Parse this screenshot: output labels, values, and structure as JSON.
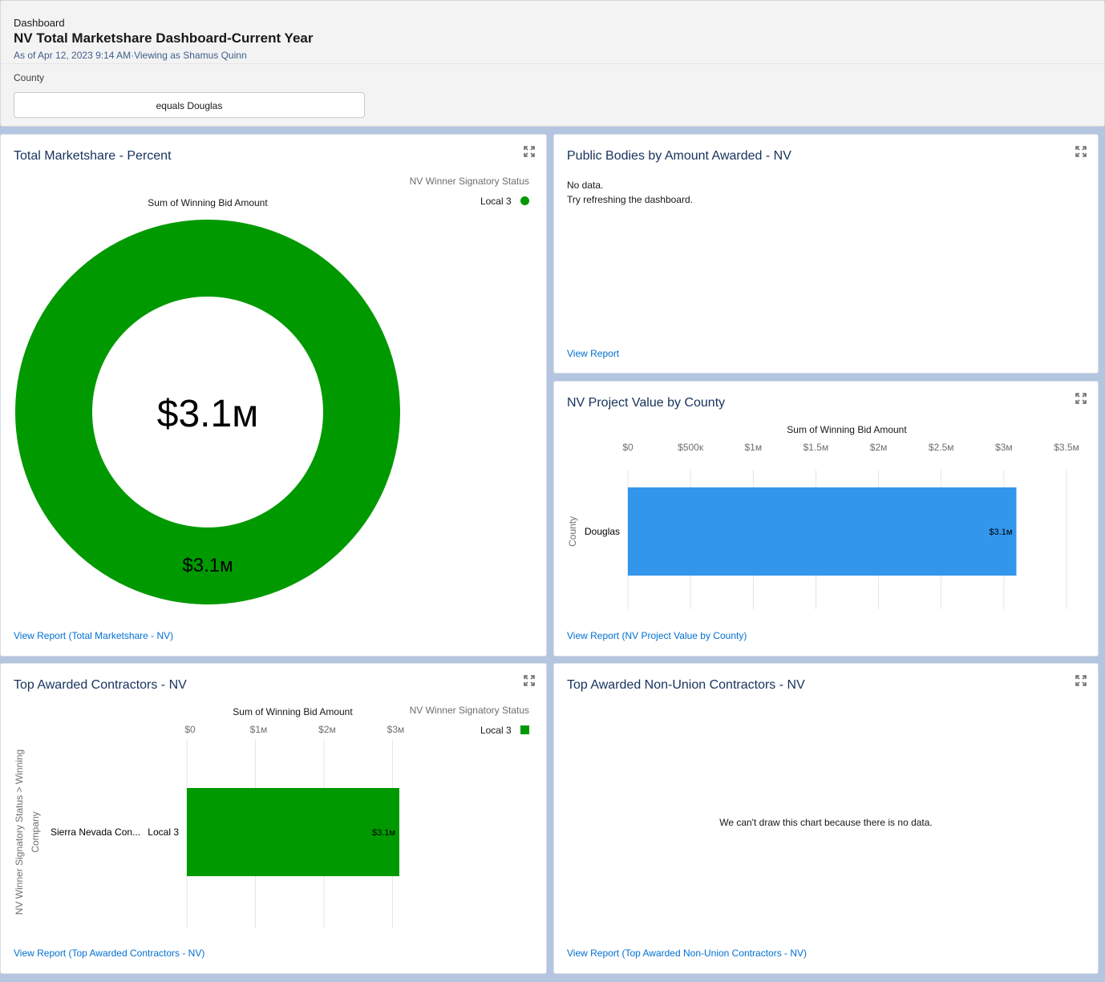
{
  "header": {
    "eyebrow": "Dashboard",
    "title": "NV Total Marketshare Dashboard-Current Year",
    "subtitle": "As of Apr 12, 2023 9:14 AM·Viewing as Shamus Quinn",
    "filter_label": "County",
    "filter_value": "equals Douglas"
  },
  "cards": {
    "marketshare": {
      "title": "Total Marketshare - Percent",
      "legend_title": "NV Winner Signatory Status",
      "legend_item": "Local 3",
      "measure_label": "Sum of Winning Bid Amount",
      "center_value": "$3.1м",
      "link": "View Report (Total Marketshare - NV)"
    },
    "public_bodies": {
      "title": "Public Bodies by Amount Awarded - NV",
      "no_data_line1": "No data.",
      "no_data_line2": "Try refreshing the dashboard.",
      "link": "View Report"
    },
    "project_value": {
      "title": "NV Project Value by County",
      "axis_title": "Sum of Winning Bid Amount",
      "y_axis_title": "County",
      "link": "View Report (NV Project Value by County)"
    },
    "top_contractors": {
      "title": "Top Awarded Contractors - NV",
      "axis_title": "Sum of Winning Bid Amount",
      "legend_title": "NV Winner Signatory Status",
      "legend_item": "Local 3",
      "y_axis_title_line1": "NV Winner Signatory Status  >  Winning",
      "y_axis_title_line2": "Company",
      "link": "View Report (Top Awarded Contractors - NV)"
    },
    "non_union": {
      "title": "Top Awarded Non-Union Contractors - NV",
      "message": "We can't draw this chart because there is no data.",
      "link": "View Report (Top Awarded Non-Union Contractors - NV)"
    }
  },
  "colors": {
    "green": "#009900",
    "blue": "#3296ed",
    "link": "#0070d2",
    "title": "#16325c"
  },
  "icons": [
    "expand-icon"
  ],
  "chart_data": [
    {
      "type": "pie",
      "variant": "donut",
      "title": "Total Marketshare - Percent",
      "measure": "Sum of Winning Bid Amount",
      "legend_title": "NV Winner Signatory Status",
      "legend_position": "top-right",
      "slices": [
        {
          "name": "Local 3",
          "value": 3.1,
          "label": "$3.1м",
          "color": "#009900"
        }
      ],
      "center_label": "$3.1м"
    },
    {
      "type": "bar",
      "orientation": "horizontal",
      "title": "NV Project Value by County",
      "xlabel": "Sum of Winning Bid Amount",
      "ylabel": "County",
      "categories": [
        "Douglas"
      ],
      "values": [
        3.1
      ],
      "value_labels": [
        "$3.1м"
      ],
      "xlim": [
        0,
        3.5
      ],
      "xticks": [
        0,
        0.5,
        1,
        1.5,
        2,
        2.5,
        3,
        3.5
      ],
      "xtick_labels": [
        "$0",
        "$500к",
        "$1м",
        "$1.5м",
        "$2м",
        "$2.5м",
        "$3м",
        "$3.5м"
      ],
      "color": "#3296ed",
      "grid": true
    },
    {
      "type": "bar",
      "orientation": "horizontal",
      "title": "Top Awarded Contractors - NV",
      "xlabel": "Sum of Winning Bid Amount",
      "ylabel": "NV Winner Signatory Status > Winning Company",
      "categories": [
        {
          "group": "Local 3",
          "name": "Sierra Nevada Con..."
        }
      ],
      "values": [
        3.1
      ],
      "value_labels": [
        "$3.1м"
      ],
      "xlim": [
        0,
        3.1
      ],
      "xticks": [
        0,
        1,
        2,
        3
      ],
      "xtick_labels": [
        "$0",
        "$1м",
        "$2м",
        "$3м"
      ],
      "legend_title": "NV Winner Signatory Status",
      "legend_position": "top-right",
      "series": [
        {
          "name": "Local 3",
          "color": "#009900"
        }
      ],
      "grid": true
    }
  ]
}
